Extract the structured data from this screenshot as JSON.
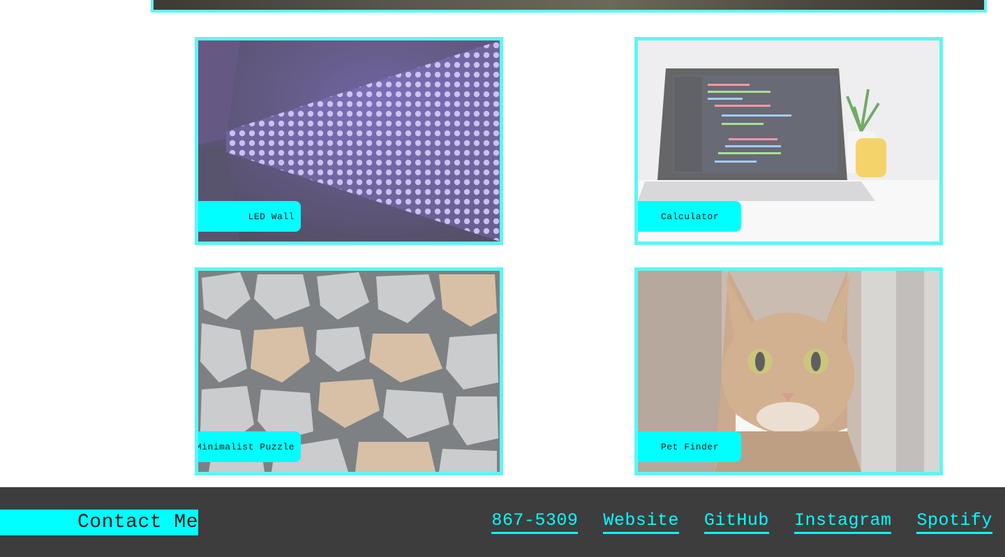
{
  "projects": [
    {
      "title": "LED Wall",
      "image": "led-wall-photo"
    },
    {
      "title": "Calculator",
      "image": "laptop-code-photo"
    },
    {
      "title": "Minimalist Puzzle",
      "image": "stone-tiles-photo"
    },
    {
      "title": "Pet Finder",
      "image": "cat-photo"
    }
  ],
  "footer": {
    "heading": "Contact Me",
    "links": [
      "867-5309",
      "Website",
      "GitHub",
      "Instagram",
      "Spotify"
    ]
  },
  "colors": {
    "accent": "#00ffff",
    "border": "#5ff5f5",
    "footer_bg": "#3d3d3d"
  }
}
